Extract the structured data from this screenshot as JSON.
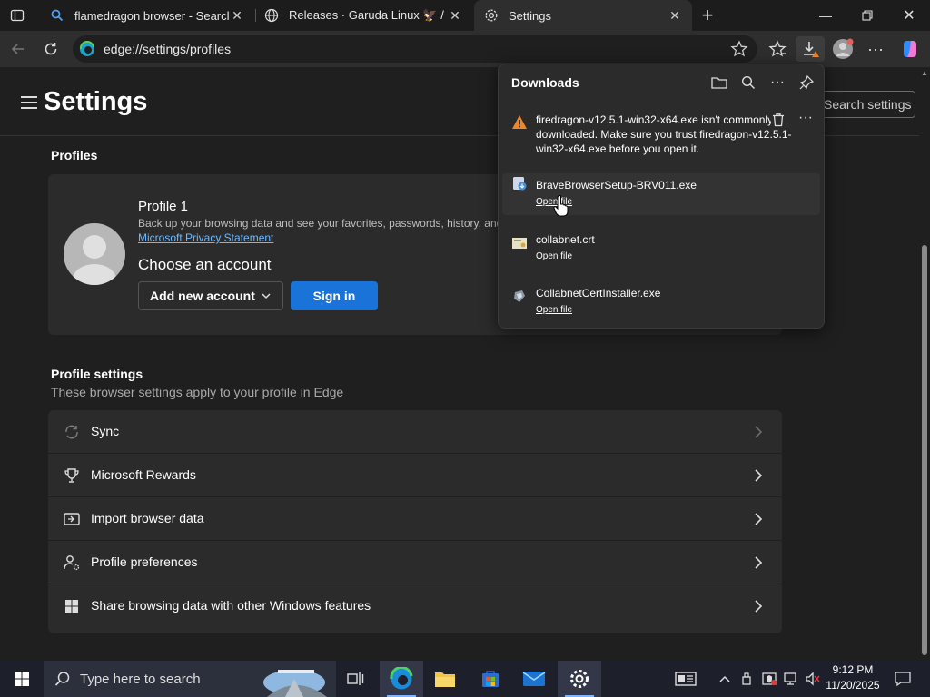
{
  "tabs": [
    {
      "label": "flamedragon browser - Search",
      "icon": "search-icon"
    },
    {
      "label": "Releases · Garuda Linux 🦅 / Firef",
      "icon": "globe-icon"
    },
    {
      "label": "Settings",
      "icon": "gear-icon"
    }
  ],
  "address_bar": {
    "url": "edge://settings/profiles"
  },
  "settings": {
    "title": "Settings",
    "search_placeholder": "Search settings",
    "profiles_heading": "Profiles",
    "profile": {
      "name": "Profile 1",
      "description": "Back up your browsing data and see your favorites, passwords, history, and",
      "privacy_link": "Microsoft Privacy Statement",
      "choose_account": "Choose an account",
      "add_account_label": "Add new account",
      "sign_in_label": "Sign in"
    },
    "profile_settings_heading": "Profile settings",
    "profile_settings_sub": "These browser settings apply to your profile in Edge",
    "items": [
      {
        "label": "Sync",
        "icon": "sync-icon"
      },
      {
        "label": "Microsoft Rewards",
        "icon": "trophy-icon"
      },
      {
        "label": "Import browser data",
        "icon": "import-icon"
      },
      {
        "label": "Profile preferences",
        "icon": "people-settings-icon"
      },
      {
        "label": "Share browsing data with other Windows features",
        "icon": "windows-icon"
      }
    ]
  },
  "downloads": {
    "title": "Downloads",
    "items": [
      {
        "warning": "firedragon-v12.5.1-win32-x64.exe isn't commonly downloaded. Make sure you trust firedragon-v12.5.1-win32-x64.exe before you open it.",
        "icon": "warning-icon"
      },
      {
        "name": "BraveBrowserSetup-BRV011.exe",
        "action": "Open file",
        "icon": "installer-icon"
      },
      {
        "name": "collabnet.crt",
        "action": "Open file",
        "icon": "certificate-icon"
      },
      {
        "name": "CollabnetCertInstaller.exe",
        "action": "Open file",
        "icon": "app-icon"
      }
    ]
  },
  "taskbar": {
    "search_placeholder": "Type here to search",
    "time": "9:12 PM",
    "date": "11/20/2025"
  },
  "colors": {
    "accent": "#1a73d9",
    "link": "#6cb8ff",
    "warning": "#f0862c"
  }
}
